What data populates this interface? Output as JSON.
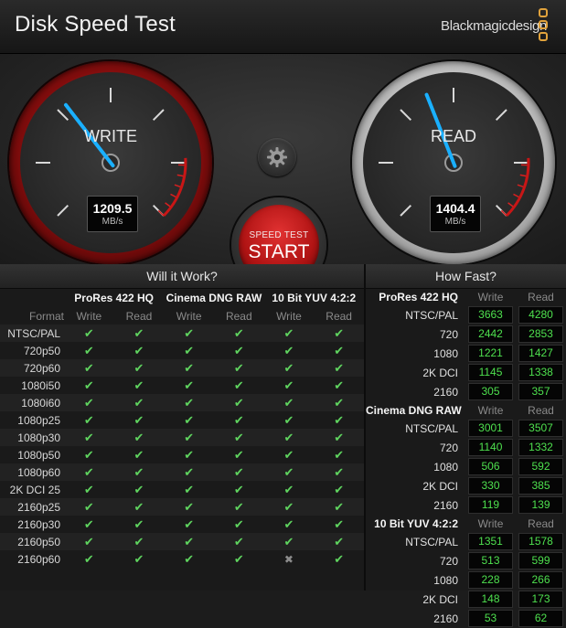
{
  "window": {
    "title": "Disk Speed Test",
    "brand": "Blackmagicdesign"
  },
  "colors": {
    "accent_red": "#c41818",
    "check_green": "#5fd45f",
    "value_green": "#4ee04e",
    "needle_blue": "#1ab0ff"
  },
  "write_gauge": {
    "label": "WRITE",
    "value": "1209.5",
    "unit": "MB/s",
    "needle_fraction": 0.36
  },
  "read_gauge": {
    "label": "READ",
    "value": "1404.4",
    "unit": "MB/s",
    "needle_fraction": 0.42
  },
  "start_button": {
    "small_label": "SPEED TEST",
    "big_label": "START"
  },
  "will_it_work": {
    "title": "Will it Work?",
    "format_header": "Format",
    "codecs": [
      "ProRes 422 HQ",
      "Cinema DNG RAW",
      "10 Bit YUV 4:2:2"
    ],
    "write_label": "Write",
    "read_label": "Read",
    "rows": [
      {
        "format": "NTSC/PAL",
        "results": [
          true,
          true,
          true,
          true,
          true,
          true
        ]
      },
      {
        "format": "720p50",
        "results": [
          true,
          true,
          true,
          true,
          true,
          true
        ]
      },
      {
        "format": "720p60",
        "results": [
          true,
          true,
          true,
          true,
          true,
          true
        ]
      },
      {
        "format": "1080i50",
        "results": [
          true,
          true,
          true,
          true,
          true,
          true
        ]
      },
      {
        "format": "1080i60",
        "results": [
          true,
          true,
          true,
          true,
          true,
          true
        ]
      },
      {
        "format": "1080p25",
        "results": [
          true,
          true,
          true,
          true,
          true,
          true
        ]
      },
      {
        "format": "1080p30",
        "results": [
          true,
          true,
          true,
          true,
          true,
          true
        ]
      },
      {
        "format": "1080p50",
        "results": [
          true,
          true,
          true,
          true,
          true,
          true
        ]
      },
      {
        "format": "1080p60",
        "results": [
          true,
          true,
          true,
          true,
          true,
          true
        ]
      },
      {
        "format": "2K DCI 25",
        "results": [
          true,
          true,
          true,
          true,
          true,
          true
        ]
      },
      {
        "format": "2160p25",
        "results": [
          true,
          true,
          true,
          true,
          true,
          true
        ]
      },
      {
        "format": "2160p30",
        "results": [
          true,
          true,
          true,
          true,
          true,
          true
        ]
      },
      {
        "format": "2160p50",
        "results": [
          true,
          true,
          true,
          true,
          true,
          true
        ]
      },
      {
        "format": "2160p60",
        "results": [
          true,
          true,
          true,
          true,
          false,
          true
        ]
      }
    ]
  },
  "how_fast": {
    "title": "How Fast?",
    "write_label": "Write",
    "read_label": "Read",
    "groups": [
      {
        "codec": "ProRes 422 HQ",
        "rows": [
          {
            "label": "NTSC/PAL",
            "write": "3663",
            "read": "4280"
          },
          {
            "label": "720",
            "write": "2442",
            "read": "2853"
          },
          {
            "label": "1080",
            "write": "1221",
            "read": "1427"
          },
          {
            "label": "2K DCI",
            "write": "1145",
            "read": "1338"
          },
          {
            "label": "2160",
            "write": "305",
            "read": "357"
          }
        ]
      },
      {
        "codec": "Cinema DNG RAW",
        "rows": [
          {
            "label": "NTSC/PAL",
            "write": "3001",
            "read": "3507"
          },
          {
            "label": "720",
            "write": "1140",
            "read": "1332"
          },
          {
            "label": "1080",
            "write": "506",
            "read": "592"
          },
          {
            "label": "2K DCI",
            "write": "330",
            "read": "385"
          },
          {
            "label": "2160",
            "write": "119",
            "read": "139"
          }
        ]
      },
      {
        "codec": "10 Bit YUV 4:2:2",
        "rows": [
          {
            "label": "NTSC/PAL",
            "write": "1351",
            "read": "1578"
          },
          {
            "label": "720",
            "write": "513",
            "read": "599"
          },
          {
            "label": "1080",
            "write": "228",
            "read": "266"
          },
          {
            "label": "2K DCI",
            "write": "148",
            "read": "173"
          },
          {
            "label": "2160",
            "write": "53",
            "read": "62"
          }
        ]
      }
    ]
  }
}
